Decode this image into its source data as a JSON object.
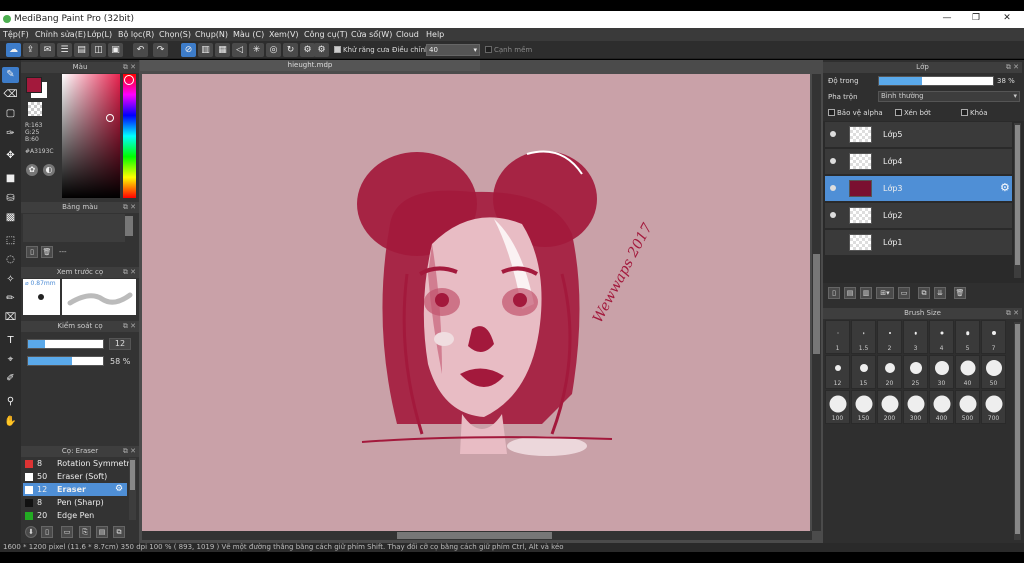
{
  "window": {
    "title": "MediBang Paint Pro (32bit)",
    "minimize": "—",
    "maximize": "❐",
    "close": "✕"
  },
  "menu": [
    "Tệp(F)",
    "Chỉnh sửa(E)",
    "Lớp(L)",
    "Bộ lọc(R)",
    "Chọn(S)",
    "Chụp(N)",
    "Màu (C)",
    "Xem(V)",
    "Công cụ(T)",
    "Cửa sổ(W)",
    "Cloud",
    "Help"
  ],
  "toolbar": {
    "antialias_label": "Khử răng cưa",
    "adjust_label": "Điều chỉnh",
    "adjust_value": "40",
    "edge_label": "Cạnh mềm"
  },
  "document": {
    "tab": "hieught.mdp",
    "signature": "Wewwaps 2017"
  },
  "color_panel": {
    "title": "Màu",
    "r": "R:163",
    "g": "G:25",
    "b": "B:60",
    "hex": "#A3193C",
    "primary_color": "#A3193C",
    "secondary_color": "#ffffff"
  },
  "palette_panel": {
    "title": "Bảng màu",
    "placeholder": "---"
  },
  "brush_preview": {
    "title": "Xem trước cọ",
    "size": "0.87mm"
  },
  "brush_control": {
    "title": "Kiểm soát cọ",
    "size_value": "12",
    "size_fraction": 0.23,
    "opacity_value": "58 %",
    "opacity_fraction": 0.58
  },
  "brush_list": {
    "title": "Cọ: Eraser",
    "items": [
      {
        "num": "8",
        "name": "Rotation Symmetry",
        "color": "#d33"
      },
      {
        "num": "50",
        "name": "Eraser (Soft)",
        "color": "#fff"
      },
      {
        "num": "12",
        "name": "Eraser",
        "color": "#fff"
      },
      {
        "num": "8",
        "name": "Pen (Sharp)",
        "color": "#111"
      },
      {
        "num": "20",
        "name": "Edge Pen",
        "color": "#2a2"
      }
    ]
  },
  "layer_panel": {
    "title": "Lớp",
    "opacity_label": "Độ trong",
    "opacity_value": "38 %",
    "opacity_fraction": 0.38,
    "blend_label": "Pha trộn",
    "blend_value": "Bình thường",
    "protect_alpha": "Bảo vệ alpha",
    "clipping": "Xén bớt",
    "lock": "Khóa",
    "layers": [
      "Lớp5",
      "Lớp4",
      "Lớp3",
      "Lớp2",
      "Lớp1"
    ]
  },
  "brush_size": {
    "title": "Brush Size",
    "sizes": [
      "1",
      "1.5",
      "2",
      "3",
      "4",
      "5",
      "7",
      "12",
      "15",
      "20",
      "25",
      "30",
      "40",
      "50",
      "100",
      "150",
      "200",
      "300",
      "400",
      "500",
      "700"
    ]
  },
  "status": {
    "text": "1600 * 1200 pixel    (11.6 * 8.7cm)    350 dpi    100 %    ( 893, 1019 )    Vẽ một đường thẳng bằng cách giữ phím Shift. Thay đổi cỡ cọ bằng cách giữ phím Ctrl, Alt và kéo"
  }
}
